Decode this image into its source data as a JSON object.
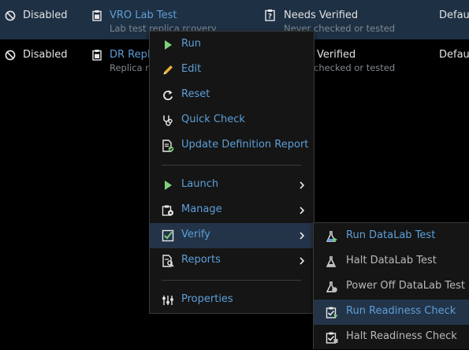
{
  "rows": [
    {
      "status": "Disabled",
      "plan_name": "VRO Lab Test",
      "plan_desc": "Lab test replica rcovery",
      "verification_status": "Needs Verified",
      "verification_detail": "Never checked or tested",
      "site": "Defaul"
    },
    {
      "status": "Disabled",
      "plan_name": "DR Repli",
      "plan_desc": "Replica r",
      "verification_status": "Verified",
      "verification_detail": "checked or tested",
      "site": "Defaul"
    }
  ],
  "context_menu": {
    "items": [
      {
        "label": "Run",
        "icon": "play-icon"
      },
      {
        "label": "Edit",
        "icon": "pencil-icon"
      },
      {
        "label": "Reset",
        "icon": "reset-icon"
      },
      {
        "label": "Quick Check",
        "icon": "stethoscope-icon"
      },
      {
        "label": "Update Definition Report",
        "icon": "report-update-icon"
      },
      {
        "label": "Launch",
        "icon": "play-icon"
      },
      {
        "label": "Manage",
        "icon": "manage-icon"
      },
      {
        "label": "Verify",
        "icon": "checkbox-icon"
      },
      {
        "label": "Reports",
        "icon": "reports-icon"
      },
      {
        "label": "Properties",
        "icon": "sliders-icon"
      }
    ]
  },
  "submenu": {
    "items": [
      {
        "label": "Run DataLab Test",
        "icon": "flask-run-icon"
      },
      {
        "label": "Halt DataLab Test",
        "icon": "flask-halt-icon"
      },
      {
        "label": "Power Off DataLab Test",
        "icon": "flask-power-icon"
      },
      {
        "label": "Run Readiness Check",
        "icon": "clipboard-check-icon"
      },
      {
        "label": "Halt Readiness Check",
        "icon": "clipboard-halt-icon"
      }
    ]
  },
  "colors": {
    "background": "#000000",
    "selected_row": "#1e3044",
    "link_blue": "#5d9fd8",
    "menu_bg": "#151515",
    "menu_active": "#233449",
    "play_green": "#7fd17a"
  }
}
